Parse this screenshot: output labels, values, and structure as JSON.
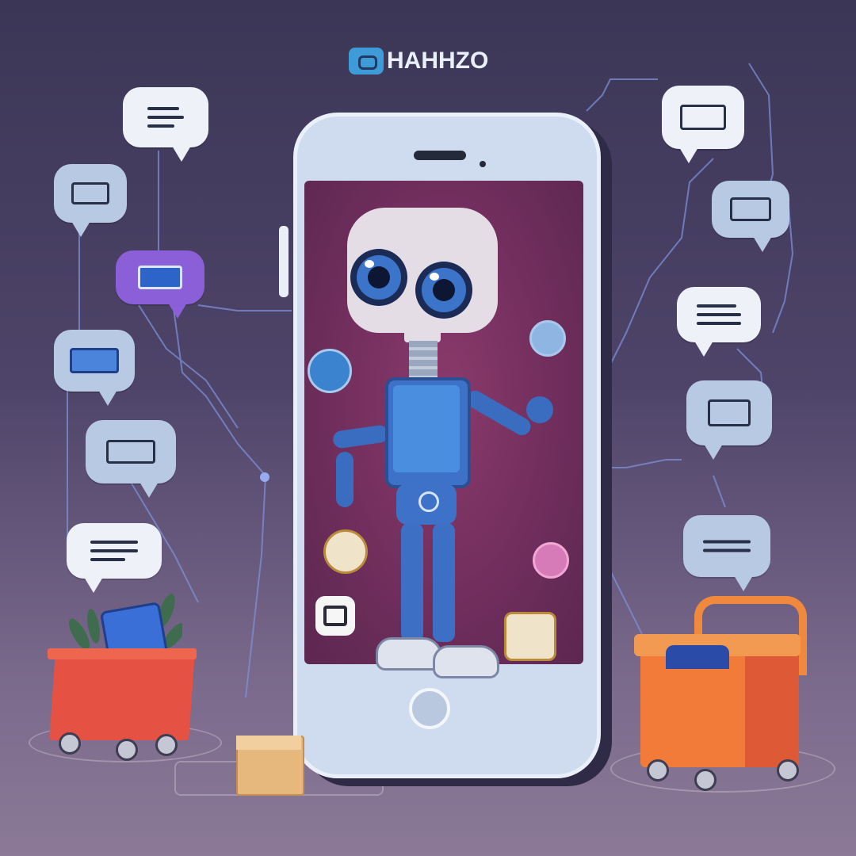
{
  "logo": {
    "text": "HAHHZO",
    "mark_icon": "chat-bubble-icon"
  },
  "colors": {
    "background_top": "#3b3656",
    "background_bottom": "#8b7997",
    "phone_frame": "#cfdcef",
    "screen": "#6e2d5c",
    "robot_blue": "#3e72c8",
    "cart_red": "#e55243",
    "cart_orange": "#f27b3a"
  },
  "phone": {
    "home_button_icon": "circle-icon"
  },
  "robot": {
    "eyes": 2
  },
  "chat_bubbles": [
    {
      "id": "b1",
      "icon": "text-lines-icon"
    },
    {
      "id": "b2",
      "icon": "card-icon"
    },
    {
      "id": "b3",
      "icon": "card-icon"
    },
    {
      "id": "b4",
      "icon": "card-icon"
    },
    {
      "id": "b5",
      "icon": "card-icon"
    },
    {
      "id": "b6",
      "icon": "text-lines-icon"
    },
    {
      "id": "b7",
      "icon": "card-icon"
    },
    {
      "id": "b8",
      "icon": "card-icon"
    },
    {
      "id": "b9",
      "icon": "text-lines-icon"
    },
    {
      "id": "b10",
      "icon": "card-icon"
    },
    {
      "id": "b11",
      "icon": "text-lines-icon"
    }
  ],
  "objects": [
    "shopping-cart-left",
    "shopping-cart-right",
    "cardboard-box"
  ]
}
